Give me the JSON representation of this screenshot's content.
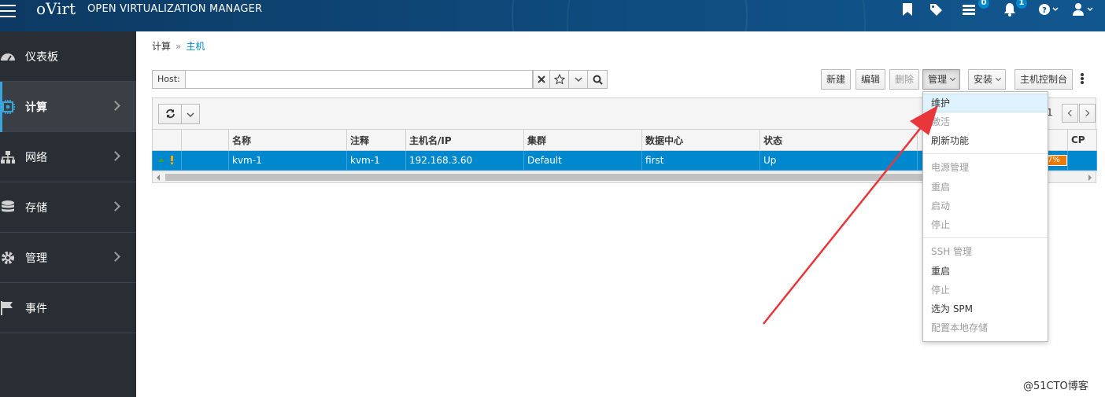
{
  "navbar": {
    "brand_logo": "oVirt",
    "brand_name": "OPEN VIRTUALIZATION MANAGER",
    "tasks_badge": "0",
    "events_badge": "1",
    "icons": [
      "bookmark-icon",
      "tag-icon",
      "tasks-icon",
      "bell-icon",
      "help-icon",
      "user-icon"
    ]
  },
  "sidebar": {
    "items": [
      {
        "label": "仪表板",
        "icon": "dashboard-icon",
        "active": false
      },
      {
        "label": "计算",
        "icon": "cpu-icon",
        "active": true
      },
      {
        "label": "网络",
        "icon": "network-icon",
        "active": false
      },
      {
        "label": "存储",
        "icon": "database-icon",
        "active": false
      },
      {
        "label": "管理",
        "icon": "gear-icon",
        "active": false
      },
      {
        "label": "事件",
        "icon": "flag-icon",
        "active": false
      }
    ]
  },
  "breadcrumb": {
    "parent": "计算",
    "separator": "»",
    "current": "主机"
  },
  "search": {
    "label": "Host:",
    "value": ""
  },
  "toolbar": {
    "new": "新建",
    "edit": "编辑",
    "remove": "删除",
    "manage": "管理",
    "install": "安装",
    "host_console": "主机控制台"
  },
  "pager": {
    "range": "1"
  },
  "grid": {
    "columns": [
      "",
      "",
      "名称",
      "注释",
      "主机名/IP",
      "集群",
      "数据中心",
      "状态",
      "",
      "CP"
    ],
    "rows": [
      {
        "name": "kvm-1",
        "comment": "kvm-1",
        "hostname": "192.168.3.60",
        "cluster": "Default",
        "datacenter": "first",
        "status": "Up",
        "memory": "7%"
      }
    ]
  },
  "manage_menu": {
    "items": [
      {
        "label": "维护",
        "disabled": false,
        "hover": true
      },
      {
        "label": "激活",
        "disabled": true
      },
      {
        "label": "刷新功能",
        "disabled": false
      },
      {
        "label": "电源管理",
        "disabled": true
      },
      {
        "label": "重启",
        "disabled": true
      },
      {
        "label": "启动",
        "disabled": true
      },
      {
        "label": "停止",
        "disabled": true
      },
      {
        "label": "SSH 管理",
        "disabled": true
      },
      {
        "label": "重启",
        "disabled": false
      },
      {
        "label": "停止",
        "disabled": true
      },
      {
        "label": "选为 SPM",
        "disabled": false
      },
      {
        "label": "配置本地存储",
        "disabled": true
      }
    ]
  },
  "colors": {
    "navbar": "#0f4b7e",
    "sidebar": "#292e34",
    "selected_row": "#0088ce",
    "accent": "#39a5dc",
    "annotation_arrow": "#e8363a"
  },
  "watermark": "@51CTO博客"
}
